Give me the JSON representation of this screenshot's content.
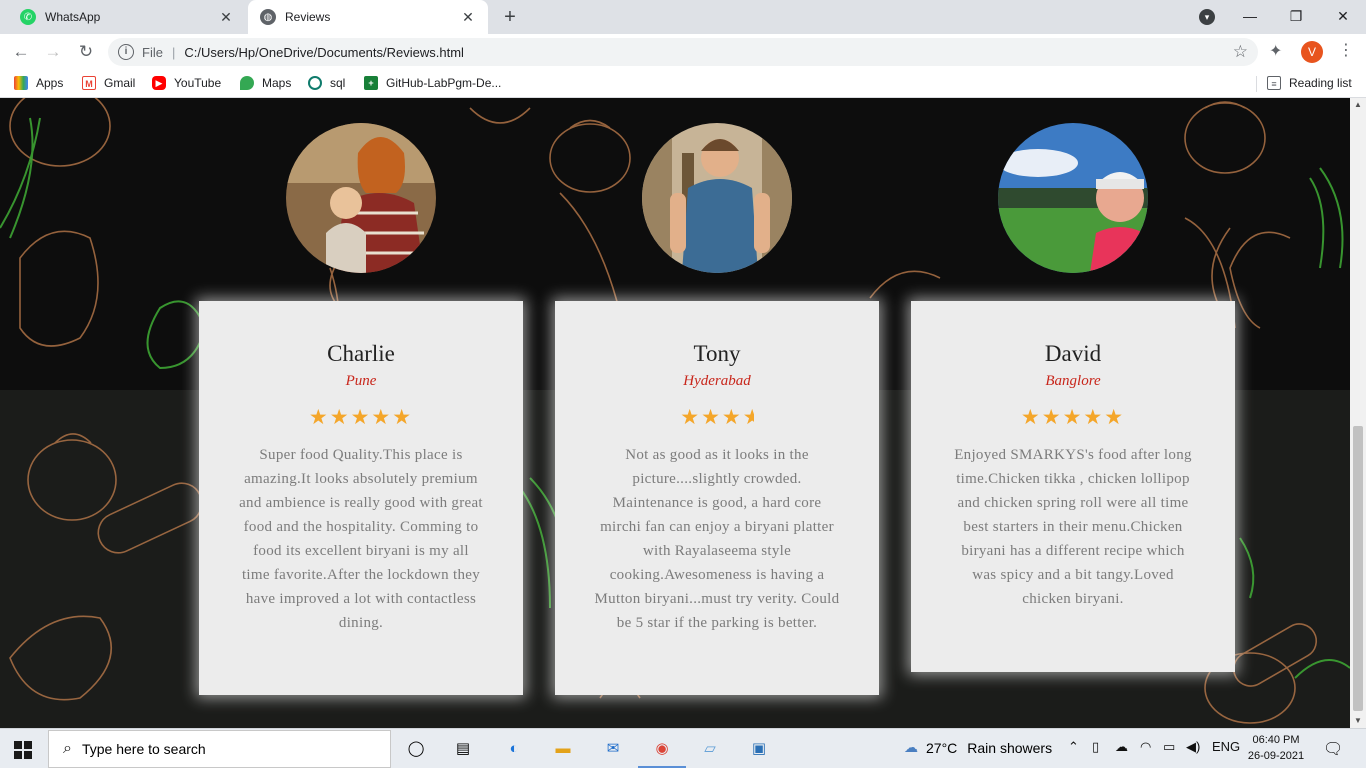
{
  "browser": {
    "tabs": [
      {
        "title": "WhatsApp",
        "favicon": "whatsapp-icon",
        "active": false
      },
      {
        "title": "Reviews",
        "favicon": "globe-icon",
        "active": true
      }
    ],
    "address": {
      "scheme_label": "File",
      "url": "C:/Users/Hp/OneDrive/Documents/Reviews.html"
    },
    "profile_initial": "V",
    "bookmarks": [
      {
        "label": "Apps",
        "icon": "apps-grid-icon"
      },
      {
        "label": "Gmail",
        "icon": "gmail-icon"
      },
      {
        "label": "YouTube",
        "icon": "youtube-icon"
      },
      {
        "label": "Maps",
        "icon": "maps-icon"
      },
      {
        "label": "sql",
        "icon": "sql-icon"
      },
      {
        "label": "GitHub-LabPgm-De...",
        "icon": "github-sheet-icon"
      }
    ],
    "reading_list_label": "Reading list"
  },
  "reviews": [
    {
      "name": "Charlie",
      "city": "Pune",
      "rating": 5,
      "stars": "★★★★★",
      "text": "Super food Quality.This place is amazing.It looks absolutely premium and ambience is really good with great food and the hospitality. Comming to food its excellent biryani is my all time favorite.After the lockdown they have improved a lot with contactless dining."
    },
    {
      "name": "Tony",
      "city": "Hyderabad",
      "rating": 3.5,
      "stars": "★★★",
      "text": "Not as good as it looks in the picture....slightly crowded. Maintenance is good, a hard core mirchi fan can enjoy a biryani platter with Rayalaseema style cooking.Awesomeness is having a Mutton biryani...must try verity. Could be 5 star if the parking is better."
    },
    {
      "name": "David",
      "city": "Banglore",
      "rating": 5,
      "stars": "★★★★★",
      "text": "Enjoyed SMARKYS's food after long time.Chicken tikka , chicken lollipop and chicken spring roll were all time best starters in their menu.Chicken biryani has a different recipe which was spicy and a bit tangy.Loved chicken biryani."
    }
  ],
  "taskbar": {
    "search_placeholder": "Type here to search",
    "weather_temp": "27°C",
    "weather_desc": "Rain showers",
    "language": "ENG",
    "time": "06:40 PM",
    "date": "26-09-2021"
  },
  "colors": {
    "star": "#f4a62a",
    "city": "#c8261b",
    "card_bg": "#ececec",
    "page_bg": "#141414"
  }
}
